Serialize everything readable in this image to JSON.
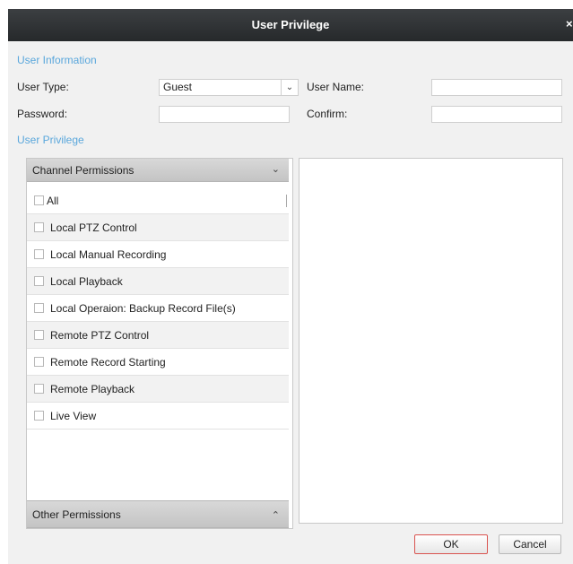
{
  "window": {
    "title": "User Privilege",
    "close_glyph": "×"
  },
  "sections": {
    "user_information": "User Information",
    "user_privilege": "User Privilege"
  },
  "form": {
    "user_type_label": "User Type:",
    "user_type_value": "Guest",
    "user_name_label": "User Name:",
    "user_name_value": "",
    "password_label": "Password:",
    "password_value": "",
    "confirm_label": "Confirm:",
    "confirm_value": ""
  },
  "channel_permissions": {
    "header": "Channel Permissions",
    "all_label": "All",
    "items": [
      "Local PTZ Control",
      "Local Manual Recording",
      "Local Playback",
      "Local Operaion: Backup Record File(s)",
      "Remote PTZ Control",
      "Remote Record Starting",
      "Remote Playback",
      "Live View"
    ]
  },
  "other_permissions": {
    "header": "Other Permissions"
  },
  "buttons": {
    "ok": "OK",
    "cancel": "Cancel"
  },
  "icons": {
    "dropdown": "chevron-down-icon",
    "collapse": "chevron-up-icon",
    "close": "close-icon"
  },
  "colors": {
    "section_title": "#5aa7dc",
    "titlebar": "#2f3235",
    "ok_border": "#d9534f"
  }
}
